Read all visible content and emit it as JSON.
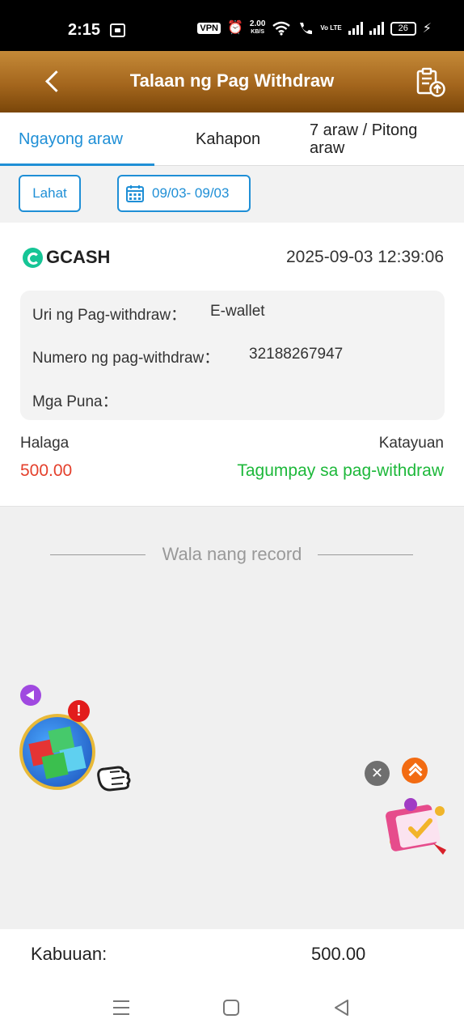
{
  "status_bar": {
    "time": "2:15",
    "vpn": "VPN",
    "speed_value": "2.00",
    "speed_unit": "KB/S",
    "volte": "Vo LTE",
    "battery": "26"
  },
  "header": {
    "title": "Talaan ng Pag Withdraw"
  },
  "tabs": [
    {
      "label": "Ngayong araw",
      "active": true
    },
    {
      "label": "Kahapon",
      "active": false
    },
    {
      "label": "7 araw / Pitong araw",
      "active": false
    }
  ],
  "filters": {
    "all_label": "Lahat",
    "date_range": "09/03- 09/03"
  },
  "record": {
    "provider": "GCASH",
    "datetime": "2025-09-03 12:39:06",
    "type_label": "Uri ng Pag-withdraw：",
    "type_value": "E-wallet",
    "number_label": "Numero ng pag-withdraw：",
    "number_value": "32188267947",
    "remarks_label": "Mga Puna：",
    "remarks_value": "",
    "amount_label": "Halaga",
    "amount_value": "500.00",
    "status_label": "Katayuan",
    "status_value": "Tagumpay sa pag-withdraw"
  },
  "no_more_text": "Wala nang record",
  "total": {
    "label": "Kabuuan:",
    "value": "500.00"
  },
  "colors": {
    "accent": "#1f8fd6",
    "header_top": "#c58a38",
    "header_bottom": "#7a4609",
    "amount": "#e4402c",
    "success": "#1db83a"
  },
  "icons": {
    "back": "chevron-left-icon",
    "upload": "clipboard-upload-icon",
    "calendar": "calendar-icon",
    "close": "close-icon",
    "scroll_top": "double-chevron-up-icon"
  }
}
